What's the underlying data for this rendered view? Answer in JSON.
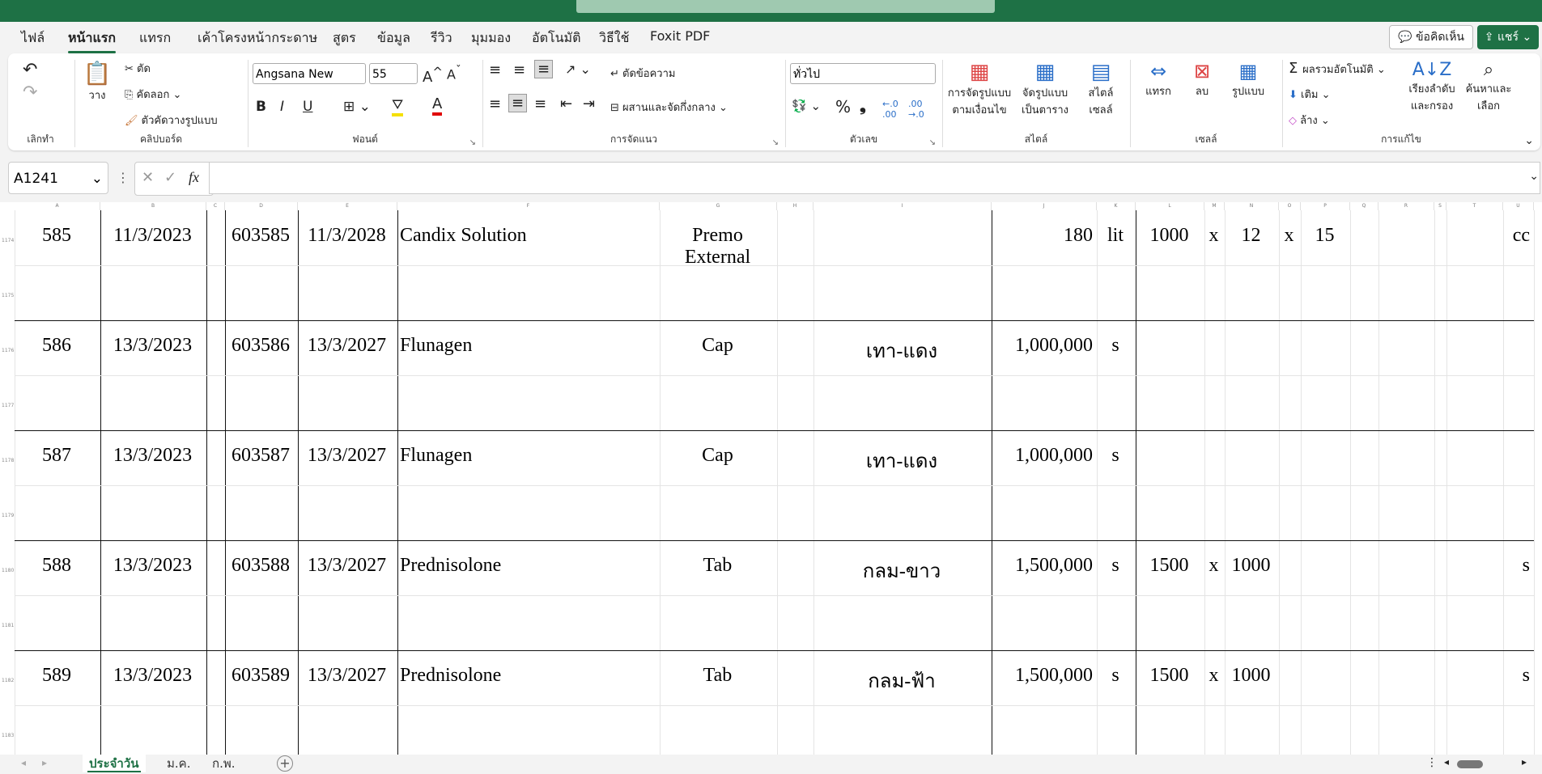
{
  "menu": {
    "tabs": [
      "ไฟล์",
      "หน้าแรก",
      "แทรก",
      "เค้าโครงหน้ากระดาษ",
      "สูตร",
      "ข้อมูล",
      "รีวิว",
      "มุมมอง",
      "อัตโนมัติ",
      "วิธีใช้",
      "Foxit PDF"
    ],
    "comment_label": "ข้อคิดเห็น",
    "share_label": "แชร์"
  },
  "ribbon": {
    "undo_label": "เลิกทำ",
    "clipboard": {
      "paste": "วาง",
      "cut": "ตัด",
      "copy": "คัดลอก",
      "format_painter": "ตัวคัดวางรูปแบบ",
      "label": "คลิปบอร์ด"
    },
    "font": {
      "name": "Angsana New",
      "size": "55",
      "label": "ฟอนต์",
      "bold": "B",
      "italic": "I",
      "underline": "U"
    },
    "alignment": {
      "wrap": "ตัดข้อความ",
      "merge": "ผสานและจัดกึ่งกลาง",
      "label": "การจัดแนว"
    },
    "number": {
      "format": "ทั่วไป",
      "label": "ตัวเลข"
    },
    "styles": {
      "conditional": "การจัดรูปแบบ ตามเงื่อนไข",
      "table": "จัดรูปแบบ เป็นตาราง",
      "cell": "สไตล์ เซลล์",
      "label": "สไตล์"
    },
    "cells": {
      "insert": "แทรก",
      "delete": "ลบ",
      "format": "รูปแบบ",
      "label": "เซลล์"
    },
    "editing": {
      "autosum": "ผลรวมอัตโนมัติ",
      "fill": "เติม",
      "clear": "ล้าง",
      "sort": "เรียงลำดับ และกรอง",
      "find": "ค้นหาและ เลือก",
      "label": "การแก้ไข"
    }
  },
  "formula_bar": {
    "name_box": "A1241",
    "fx": "fx",
    "value": ""
  },
  "columns": [
    "A",
    "B",
    "C",
    "D",
    "E",
    "F",
    "G",
    "H",
    "I",
    "J",
    "K",
    "L",
    "M",
    "N",
    "O",
    "P",
    "Q",
    "R",
    "S",
    "T",
    "U"
  ],
  "rows": [
    {
      "num_top": "1174",
      "num_bot": "1175",
      "no": "585",
      "date": "11/3/2023",
      "code": "603585",
      "exp": "11/3/2028",
      "name": "Candix Solution",
      "form": "Premo External",
      "desc": "",
      "qty": "180",
      "unit": "lit",
      "l": "1000",
      "m": "x",
      "n": "12",
      "o": "x",
      "p": "15",
      "u": "cc"
    },
    {
      "num_top": "1176",
      "num_bot": "1177",
      "no": "586",
      "date": "13/3/2023",
      "code": "603586",
      "exp": "13/3/2027",
      "name": "Flunagen",
      "form": "Cap",
      "desc": "เทา-แดง",
      "qty": "1,000,000",
      "unit": "s",
      "l": "",
      "m": "",
      "n": "",
      "o": "",
      "p": "",
      "u": ""
    },
    {
      "num_top": "1178",
      "num_bot": "1179",
      "no": "587",
      "date": "13/3/2023",
      "code": "603587",
      "exp": "13/3/2027",
      "name": "Flunagen",
      "form": "Cap",
      "desc": "เทา-แดง",
      "qty": "1,000,000",
      "unit": "s",
      "l": "",
      "m": "",
      "n": "",
      "o": "",
      "p": "",
      "u": ""
    },
    {
      "num_top": "1180",
      "num_bot": "1181",
      "no": "588",
      "date": "13/3/2023",
      "code": "603588",
      "exp": "13/3/2027",
      "name": "Prednisolone",
      "form": "Tab",
      "desc": "กลม-ขาว",
      "qty": "1,500,000",
      "unit": "s",
      "l": "1500",
      "m": "x",
      "n": "1000",
      "o": "",
      "p": "",
      "u": "s"
    },
    {
      "num_top": "1182",
      "num_bot": "1183",
      "no": "589",
      "date": "13/3/2023",
      "code": "603589",
      "exp": "13/3/2027",
      "name": "Prednisolone",
      "form": "Tab",
      "desc": "กลม-ฟ้า",
      "qty": "1,500,000",
      "unit": "s",
      "l": "1500",
      "m": "x",
      "n": "1000",
      "o": "",
      "p": "",
      "u": "s"
    }
  ],
  "sheets": [
    "ประจำวัน",
    "ม.ค.",
    "ก.พ."
  ],
  "colors": {
    "accent": "#1e7145"
  }
}
